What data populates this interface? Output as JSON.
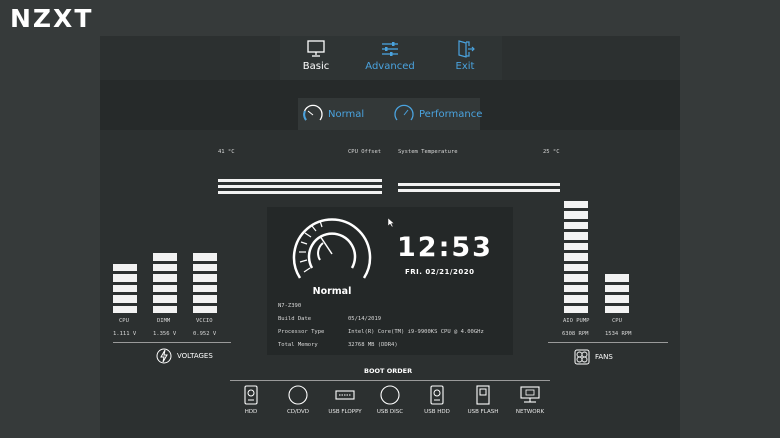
{
  "logo": "NZXT",
  "nav": {
    "basic": "Basic",
    "advanced": "Advanced",
    "exit": "Exit",
    "basic_icon": "monitor-icon",
    "advanced_icon": "sliders-icon",
    "exit_icon": "exit-door-icon"
  },
  "modes": {
    "normal": "Normal",
    "performance": "Performance"
  },
  "temps": {
    "cpu_temp": "41 °C",
    "cpu_offset_label": "CPU Offset",
    "system_temp_label": "System Temperature",
    "system_temp": "25 °C"
  },
  "gauge": {
    "label": "Normal"
  },
  "clock": {
    "time": "12:53",
    "date": "FRI. 02/21/2020"
  },
  "system_info": {
    "model": "N7-Z390",
    "build_date_label": "Build Date",
    "build_date": "05/14/2019",
    "processor_label": "Processor Type",
    "processor": "Intel(R) Core(TM) i9-9900KS CPU @ 4.00GHz",
    "memory_label": "Total Memory",
    "memory": "32768 MB (DDR4)"
  },
  "voltages": {
    "title": "VOLTAGES",
    "items": [
      {
        "label": "CPU",
        "value": "1.111 V"
      },
      {
        "label": "DIMM",
        "value": "1.356 V"
      },
      {
        "label": "VCCIO",
        "value": "0.952 V"
      }
    ]
  },
  "fans": {
    "title": "FANS",
    "items": [
      {
        "label": "AIO PUMP",
        "value": "6308 RPM"
      },
      {
        "label": "CPU",
        "value": "1534 RPM"
      }
    ]
  },
  "boot_order": {
    "title": "BOOT ORDER",
    "items": [
      {
        "label": "HDD",
        "icon": "hdd-icon"
      },
      {
        "label": "CD/DVD",
        "icon": "disc-icon"
      },
      {
        "label": "USB FLOPPY",
        "icon": "usb-icon"
      },
      {
        "label": "USB DISC",
        "icon": "disc-icon"
      },
      {
        "label": "USB HDD",
        "icon": "hdd-icon"
      },
      {
        "label": "USB FLASH",
        "icon": "usb-flash-icon"
      },
      {
        "label": "NETWORK",
        "icon": "network-icon"
      }
    ]
  },
  "colors": {
    "accent": "#4aa3df",
    "background": "#363a3a",
    "panel": "#2c3030"
  }
}
